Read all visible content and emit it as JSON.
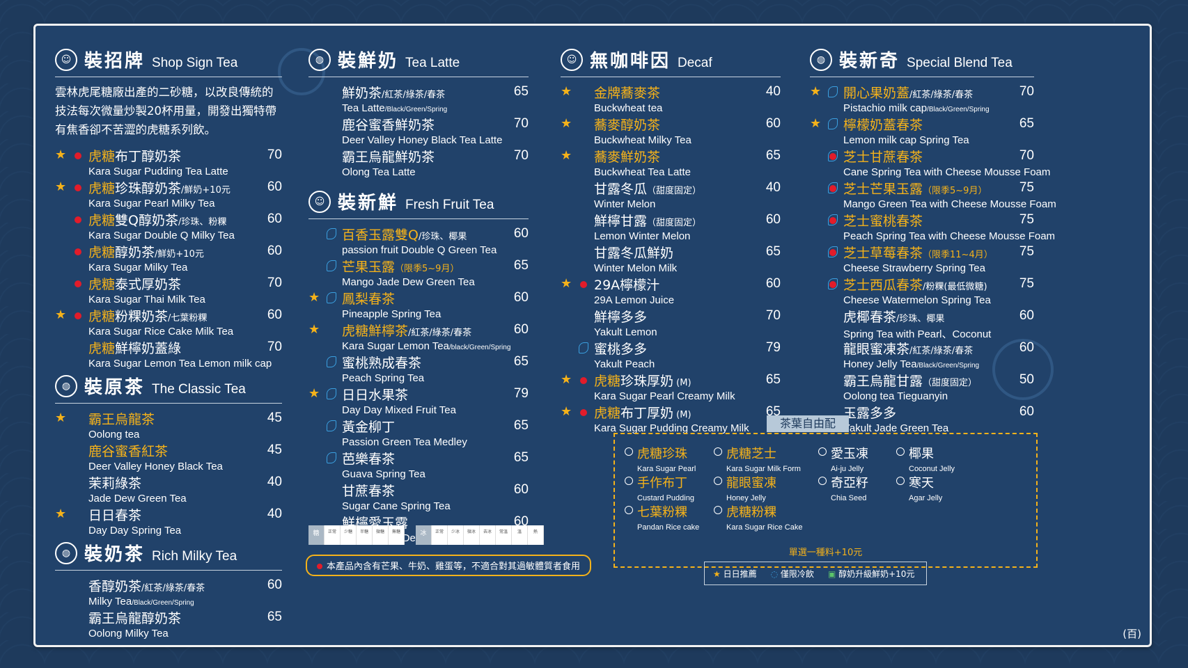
{
  "sections": {
    "sign": {
      "zh": "裝招牌",
      "en": "Shop Sign Tea",
      "intro": "雲林虎尾糖廠出產的二砂糖，以改良傳統的技法每次微量炒製20杯用量，開發出獨特帶有焦香卻不苦澀的虎糖系列飲。",
      "items": [
        {
          "star": true,
          "dot": true,
          "hl": "虎糖",
          "nm": "布丁醇奶茶",
          "sm": "",
          "en": "Kara Sugar Pudding Tea Latte",
          "pr": "70"
        },
        {
          "star": true,
          "dot": true,
          "hl": "虎糖",
          "nm": "珍珠醇奶茶",
          "sm": "/鮮奶+10元",
          "en": "Kara Sugar Pearl Milky Tea",
          "pr": "60"
        },
        {
          "star": false,
          "dot": true,
          "hl": "虎糖",
          "nm": "雙Q醇奶茶",
          "sm": "/珍珠、粉粿",
          "en": "Kara Sugar Double Q Milky Tea",
          "pr": "60"
        },
        {
          "star": false,
          "dot": true,
          "hl": "虎糖",
          "nm": "醇奶茶",
          "sm": "/鮮奶+10元",
          "en": "Kara Sugar Milky Tea",
          "pr": "60"
        },
        {
          "star": false,
          "dot": true,
          "hl": "虎糖",
          "nm": "泰式厚奶茶",
          "sm": "",
          "en": "Kara Sugar Thai Milk Tea",
          "pr": "70"
        },
        {
          "star": true,
          "dot": true,
          "hl": "虎糖",
          "nm": "粉粿奶茶",
          "sm": "/七葉粉粿",
          "en": "Kara Sugar Rice Cake Milk Tea",
          "pr": "60"
        },
        {
          "star": false,
          "dot": false,
          "hl": "虎糖",
          "nm": "鮮檸奶蓋綠",
          "sm": "",
          "en": "Kara Sugar Lemon Tea Lemon milk cap",
          "pr": "70"
        }
      ]
    },
    "classic": {
      "zh": "裝原茶",
      "en": "The Classic Tea",
      "items": [
        {
          "star": true,
          "hl": "霸王烏龍茶",
          "nm": "",
          "en": "Oolong tea",
          "pr": "45"
        },
        {
          "star": false,
          "hl": "鹿谷蜜香紅茶",
          "nm": "",
          "en": "Deer Valley Honey Black Tea",
          "pr": "45"
        },
        {
          "star": false,
          "hl": "",
          "nm": "茉莉綠茶",
          "en": "Jade Dew Green Tea",
          "pr": "40"
        },
        {
          "star": true,
          "hl": "",
          "nm": "日日春茶",
          "en": "Day Day Spring Tea",
          "pr": "40"
        }
      ]
    },
    "milky": {
      "zh": "裝奶茶",
      "en": "Rich Milky Tea",
      "items": [
        {
          "nm": "香醇奶茶",
          "sm": "/紅茶/綠茶/春茶",
          "en": "Milky Tea",
          "tiny": "/Black/Green/Spring",
          "pr": "60"
        },
        {
          "nm": "霸王烏龍醇奶茶",
          "sm": "",
          "en": "Oolong Milky Tea",
          "tiny": "",
          "pr": "65"
        }
      ]
    },
    "latte": {
      "zh": "裝鮮奶",
      "en": "Tea Latte",
      "items": [
        {
          "nm": "鮮奶茶",
          "sm": "/紅茶/綠茶/春茶",
          "en": "Tea Latte",
          "tiny": "/Black/Green/Spring",
          "pr": "65"
        },
        {
          "nm": "鹿谷蜜香鮮奶茶",
          "sm": "",
          "en": "Deer Valley Honey Black Tea Latte",
          "tiny": "",
          "pr": "70"
        },
        {
          "nm": "霸王烏龍鮮奶茶",
          "sm": "",
          "en": "Olong Tea Latte",
          "tiny": "",
          "pr": "70"
        }
      ]
    },
    "fruit": {
      "zh": "裝新鮮",
      "en": "Fresh Fruit Tea",
      "items": [
        {
          "star": false,
          "cold": true,
          "hl": "百香玉露雙Q",
          "nm": "",
          "sm": "/珍珠、椰果",
          "en": "passion fruit Double Q Green Tea",
          "pr": "60"
        },
        {
          "star": false,
          "cold": true,
          "hl": "芒果玉露",
          "nm": "",
          "sm": "（限季5~9月）",
          "smhl": true,
          "en": "Mango Jade Dew Green Tea",
          "pr": "65"
        },
        {
          "star": true,
          "cold": true,
          "hl": "鳳梨春茶",
          "nm": "",
          "sm": "",
          "en": "Pineapple Spring Tea",
          "pr": "60"
        },
        {
          "star": true,
          "cold": false,
          "hl": "虎糖鮮檸茶",
          "nm": "",
          "sm": "/紅茶/綠茶/春茶",
          "en": "Kara Sugar Lemon Tea",
          "tiny": "/black/Green/Spring",
          "pr": "60"
        },
        {
          "star": false,
          "cold": true,
          "hl": "",
          "nm": "蜜桃熟成春茶",
          "sm": "",
          "en": "Peach Spring Tea",
          "pr": "65"
        },
        {
          "star": true,
          "cold": true,
          "hl": "",
          "nm": "日日水果茶",
          "sm": "",
          "en": "Day Day Mixed Fruit Tea",
          "pr": "79"
        },
        {
          "star": false,
          "cold": true,
          "hl": "",
          "nm": "黃金柳丁",
          "sm": "",
          "en": "Passion Green Tea Medley",
          "pr": "65"
        },
        {
          "star": false,
          "cold": true,
          "hl": "",
          "nm": "芭樂春茶",
          "sm": "",
          "en": "Guava Spring Tea",
          "pr": "65"
        },
        {
          "star": false,
          "cold": false,
          "hl": "",
          "nm": "甘蔗春茶",
          "sm": "",
          "en": "Sugar Cane Spring Tea",
          "pr": "60"
        },
        {
          "star": false,
          "cold": false,
          "hl": "",
          "nm": "鮮檸愛玉露",
          "sm": "",
          "en": "Lemon Jade Dew Green Tea with Ai-ju Jelly",
          "pr": "60"
        }
      ]
    },
    "decaf": {
      "zh": "無咖啡因",
      "en": "Decaf",
      "items": [
        {
          "star": true,
          "dot": false,
          "cold": false,
          "hl": "金牌蕎麥茶",
          "nm": "",
          "sm": "",
          "en": "Buckwheat tea",
          "pr": "40"
        },
        {
          "star": true,
          "dot": false,
          "cold": false,
          "hl": "蕎麥醇奶茶",
          "nm": "",
          "sm": "",
          "en": "Buckwheat Milky Tea",
          "pr": "60"
        },
        {
          "star": true,
          "dot": false,
          "cold": false,
          "hl": "蕎麥鮮奶茶",
          "nm": "",
          "sm": "",
          "en": "Buckwheat Tea Latte",
          "pr": "65"
        },
        {
          "star": false,
          "dot": false,
          "cold": false,
          "hl": "",
          "nm": "甘露冬瓜",
          "sm": "（甜度固定）",
          "en": "Winter Melon",
          "pr": "40"
        },
        {
          "star": false,
          "dot": false,
          "cold": false,
          "hl": "",
          "nm": "鮮檸甘露",
          "sm": "（甜度固定）",
          "en": "Lemon Winter Melon",
          "pr": "60"
        },
        {
          "star": false,
          "dot": false,
          "cold": false,
          "hl": "",
          "nm": "甘露冬瓜鮮奶",
          "sm": "",
          "en": "Winter Melon Milk",
          "pr": "65"
        },
        {
          "star": true,
          "dot": true,
          "cold": false,
          "hl": "",
          "nm": "29A檸檬汁",
          "sm": "",
          "en": "29A Lemon Juice",
          "pr": "60"
        },
        {
          "star": false,
          "dot": false,
          "cold": false,
          "hl": "",
          "nm": "鮮檸多多",
          "sm": "",
          "en": "Yakult Lemon",
          "pr": "70"
        },
        {
          "star": false,
          "dot": false,
          "cold": true,
          "hl": "",
          "nm": "蜜桃多多",
          "sm": "",
          "en": "Yakult Peach",
          "pr": "79"
        },
        {
          "star": true,
          "dot": true,
          "cold": false,
          "hl": "虎糖",
          "nm": "珍珠厚奶",
          "sm": " (M)",
          "en": "Kara Sugar Pearl Creamy Milk",
          "pr": "65"
        },
        {
          "star": true,
          "dot": true,
          "cold": false,
          "hl": "虎糖",
          "nm": "布丁厚奶",
          "sm": " (M)",
          "en": "Kara Sugar Pudding Creamy Milk",
          "pr": "65"
        }
      ]
    },
    "special": {
      "zh": "裝新奇",
      "en": "Special Blend Tea",
      "items": [
        {
          "star": true,
          "dot": false,
          "cold": true,
          "hl": "開心果奶蓋",
          "nm": "",
          "sm": "/紅茶/綠茶/春茶",
          "en": "Pistachio milk cap",
          "tiny": "/Black/Green/Spring",
          "pr": "70"
        },
        {
          "star": true,
          "dot": false,
          "cold": true,
          "hl": "檸檬奶蓋春茶",
          "nm": "",
          "sm": "",
          "en": "Lemon milk cap Spring Tea",
          "pr": "65"
        },
        {
          "star": false,
          "dot": true,
          "cold": true,
          "hl": "芝士甘蔗春茶",
          "nm": "",
          "sm": "",
          "en": "Cane Spring Tea with Cheese Mousse Foam",
          "pr": "70"
        },
        {
          "star": false,
          "dot": true,
          "cold": true,
          "hl": "芝士芒果玉露",
          "nm": "",
          "sm": "（限季5~9月）",
          "smhl": true,
          "en": "Mango Green Tea with Cheese Mousse Foam",
          "pr": "75"
        },
        {
          "star": false,
          "dot": true,
          "cold": true,
          "hl": "芝士蜜桃春茶",
          "nm": "",
          "sm": "",
          "en": "Peach Spring Tea with Cheese Mousse Foam",
          "pr": "75"
        },
        {
          "star": false,
          "dot": true,
          "cold": true,
          "hl": "芝士草莓春茶",
          "nm": "",
          "sm": "（限季11~4月）",
          "smhl": true,
          "en": "Cheese Strawberry Spring Tea",
          "pr": "75"
        },
        {
          "star": false,
          "dot": true,
          "cold": true,
          "hl": "芝士西瓜春茶",
          "nm": "",
          "sm": "/粉粿(最低微糖)",
          "en": "Cheese Watermelon Spring Tea",
          "pr": "75"
        },
        {
          "star": false,
          "dot": false,
          "cold": false,
          "hl": "",
          "nm": "虎椰春茶",
          "sm": "/珍珠、椰果",
          "en": "Spring Tea with Pearl、Coconut",
          "pr": "60"
        },
        {
          "star": false,
          "dot": false,
          "cold": false,
          "hl": "",
          "nm": "龍眼蜜凍茶",
          "sm": "/紅茶/綠茶/春茶",
          "en": "Honey Jelly Tea",
          "tiny": "/Black/Green/Spring",
          "pr": "60"
        },
        {
          "star": false,
          "dot": false,
          "cold": false,
          "hl": "",
          "nm": "霸王烏龍甘露",
          "sm": "（甜度固定）",
          "en": "Oolong tea Tieguanyin",
          "pr": "50"
        },
        {
          "star": false,
          "dot": false,
          "cold": false,
          "hl": "",
          "nm": "玉露多多",
          "sm": "",
          "en": "Yakult Jade Green Tea",
          "pr": "60"
        }
      ]
    }
  },
  "toppings": {
    "title": "茶葉自由配",
    "note": "單選一種料+10元",
    "items": [
      {
        "zh": "虎糖珍珠",
        "en": "Kara Sugar Pearl",
        "hl": true
      },
      {
        "zh": "虎糖芝士",
        "en": "Kara Sugar Milk Form",
        "hl": true
      },
      {
        "zh": "愛玉凍",
        "en": "Ai-ju Jelly",
        "hl": false
      },
      {
        "zh": "椰果",
        "en": "Coconut Jelly",
        "hl": false
      },
      {
        "zh": "手作布丁",
        "en": "Custard Pudding",
        "hl": true
      },
      {
        "zh": "龍眼蜜凍",
        "en": "Honey Jelly",
        "hl": true
      },
      {
        "zh": "奇亞籽",
        "en": "Chia Seed",
        "hl": false
      },
      {
        "zh": "寒天",
        "en": "Agar Jelly",
        "hl": false
      },
      {
        "zh": "七葉粉粿",
        "en": "Pandan Rice cake",
        "hl": true
      },
      {
        "zh": "虎糖粉粿",
        "en": "Kara Sugar Rice Cake",
        "hl": true
      }
    ]
  },
  "sugar_scale": {
    "label": "糖",
    "levels": [
      "正常",
      "少糖",
      "半糖",
      "微糖",
      "無糖"
    ]
  },
  "ice_scale": {
    "label": "冰",
    "levels": [
      "正常",
      "少冰",
      "微冰",
      "去冰",
      "常溫",
      "溫",
      "熱"
    ]
  },
  "allergy": "本產品內含有芒果、牛奶、雞蛋等，不適合對其過敏體質者食用",
  "legend": {
    "star": "日日推薦",
    "cold": "僅限冷飲",
    "milk": "醇奶升級鮮奶+10元"
  },
  "page": "(百)",
  "colors": {
    "bg": "#1e3a5c",
    "board": "#21426a",
    "accent": "#f5b21a",
    "dot": "#e21c2a",
    "cold": "#3ba0e0"
  }
}
